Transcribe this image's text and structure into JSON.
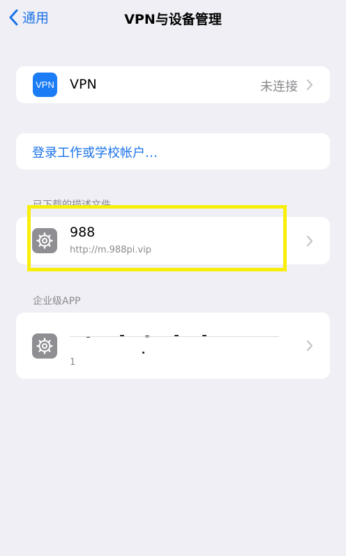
{
  "nav": {
    "back_label": "通用",
    "title": "VPN与设备管理",
    "back_icon": "chevron-left-icon"
  },
  "vpn": {
    "badge_text": "VPN",
    "title": "VPN",
    "status": "未连接"
  },
  "login": {
    "label": "登录工作或学校帐户…"
  },
  "downloaded_profiles": {
    "header": "已下载的描述文件",
    "items": [
      {
        "name": "988",
        "url": "http://m.988pi.vip",
        "icon": "gear-icon"
      }
    ]
  },
  "enterprise_apps": {
    "header": "企业级APP",
    "items": [
      {
        "name_obscured": true,
        "subtitle": "1",
        "icon": "gear-icon"
      }
    ]
  },
  "colors": {
    "accent": "#1a73e8",
    "background": "#f0eff5",
    "vpn_badge": "#1b7cf5",
    "gear_badge": "#8e8e93",
    "highlight": "#f7ef0a"
  }
}
